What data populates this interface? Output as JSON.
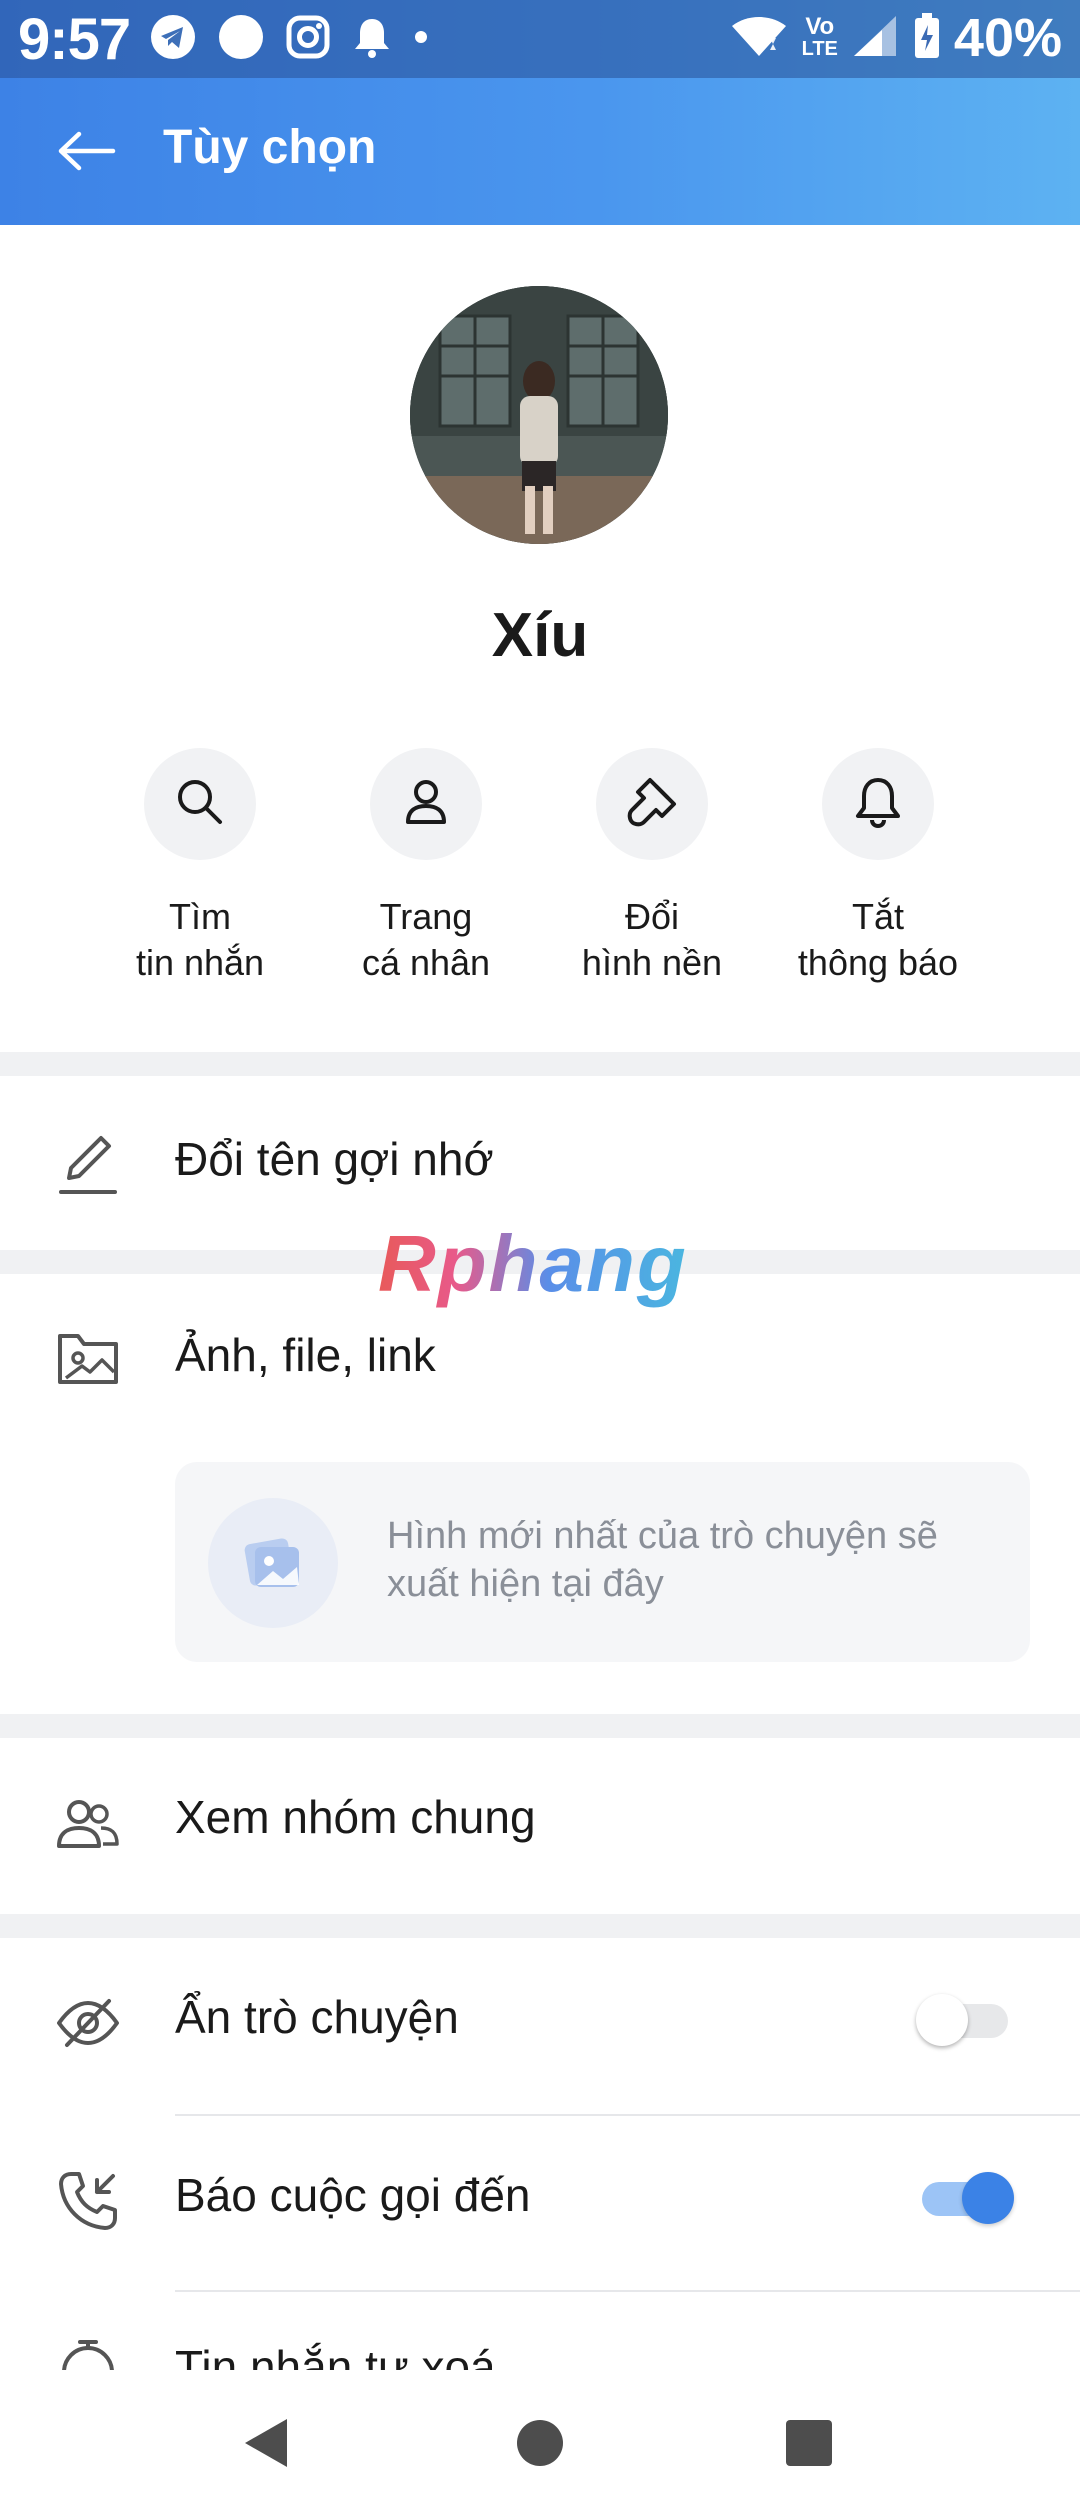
{
  "status_bar": {
    "time": "9:57",
    "battery": "40%",
    "network": "LTE",
    "volte_top": "Vo",
    "volte_bottom": "LTE"
  },
  "header": {
    "title": "Tùy chọn"
  },
  "profile": {
    "name": "Xíu"
  },
  "quick_actions": [
    {
      "label": "Tìm\ntin nhắn",
      "icon": "search-icon"
    },
    {
      "label": "Trang\ncá nhân",
      "icon": "person-icon"
    },
    {
      "label": "Đổi\nhình nền",
      "icon": "paint-brush-icon"
    },
    {
      "label": "Tắt\nthông báo",
      "icon": "bell-icon"
    }
  ],
  "rows": {
    "rename": {
      "label": "Đổi tên gợi nhớ",
      "icon": "pencil-icon"
    },
    "media": {
      "label": "Ảnh, file, link",
      "icon": "folder-image-icon",
      "empty_text": "Hình mới nhất của trò chuyện sẽ xuất hiện tại đây"
    },
    "groups": {
      "label": "Xem nhóm chung",
      "icon": "people-icon"
    },
    "hide_chat": {
      "label": "Ẩn trò chuyện",
      "icon": "eye-off-icon",
      "enabled": false
    },
    "incoming_call": {
      "label": "Báo cuộc gọi đến",
      "icon": "incoming-call-icon",
      "enabled": true
    },
    "auto_delete": {
      "label": "Tin nhắn tự xoá",
      "icon": "timer-icon"
    }
  },
  "watermark": "Rphang",
  "colors": {
    "header_start": "#3d82e6",
    "header_end": "#5db2f2",
    "toggle_on": "#3b82e6",
    "divider": "#f0f1f3"
  }
}
